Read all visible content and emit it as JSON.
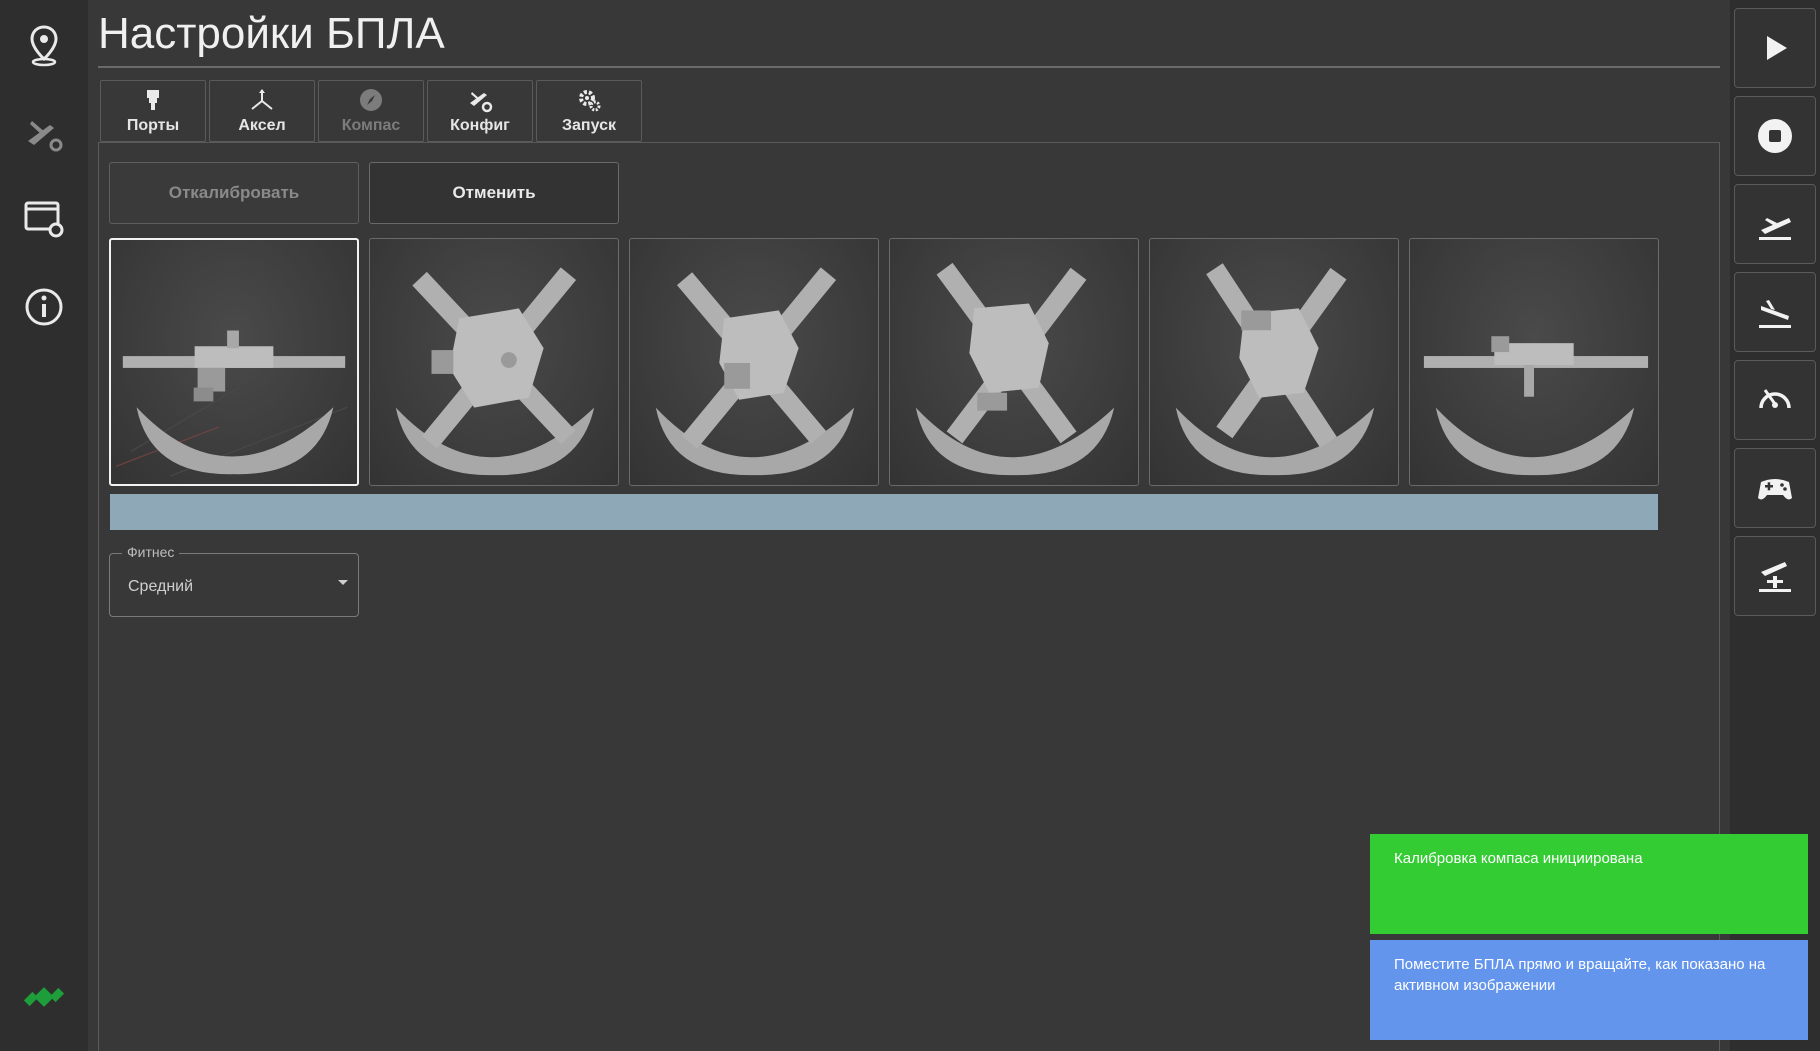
{
  "page": {
    "title": "Настройки БПЛА"
  },
  "left_sidebar": {
    "items": [
      {
        "icon": "map-pin-icon"
      },
      {
        "icon": "drone-settings-icon"
      },
      {
        "icon": "window-settings-icon"
      },
      {
        "icon": "info-icon"
      }
    ],
    "status_icon": "satellite-icon",
    "status_color": "#1e9e3a"
  },
  "tabs": [
    {
      "label": "Порты",
      "icon": "port-icon",
      "disabled": false
    },
    {
      "label": "Аксел",
      "icon": "axes-icon",
      "disabled": false
    },
    {
      "label": "Компас",
      "icon": "compass-icon",
      "disabled": true
    },
    {
      "label": "Конфиг",
      "icon": "plane-gear-icon",
      "disabled": false
    },
    {
      "label": "Запуск",
      "icon": "gears-icon",
      "disabled": false
    }
  ],
  "actions": {
    "calibrate_label": "Откалибровать",
    "cancel_label": "Отменить"
  },
  "orientations": {
    "active_index": 0,
    "count": 6
  },
  "progress": {
    "value": 1.0,
    "color": "#8fa8b8"
  },
  "fitness": {
    "legend": "Фитнес",
    "value": "Средний"
  },
  "right_sidebar": {
    "buttons": [
      {
        "icon": "play-icon"
      },
      {
        "icon": "stop-icon"
      },
      {
        "icon": "takeoff-icon"
      },
      {
        "icon": "landing-icon"
      },
      {
        "icon": "speedometer-icon"
      },
      {
        "icon": "gamepad-icon"
      },
      {
        "icon": "launch-pad-icon"
      }
    ]
  },
  "notifications": [
    {
      "text": "Калибровка компаса инициирована",
      "color": "#33cc33"
    },
    {
      "text": "Поместите БПЛА прямо и вращайте, как показано на активном изображении",
      "color": "#6495ed"
    }
  ]
}
